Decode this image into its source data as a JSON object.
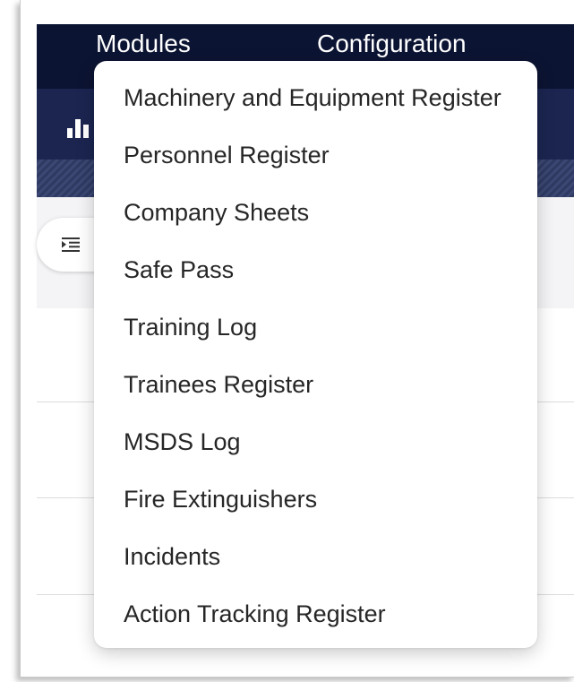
{
  "nav": {
    "modules_label": "Modules",
    "configuration_label": "Configuration"
  },
  "toolbar": {
    "chart_icon": "bar-chart-icon",
    "indent_icon": "indent-icon"
  },
  "modules_menu": {
    "items": [
      "Machinery and Equipment Register",
      "Personnel Register",
      "Company Sheets",
      "Safe Pass",
      "Training Log",
      "Trainees Register",
      "MSDS Log",
      "Fire Extinguishers",
      "Incidents",
      "Action Tracking Register"
    ]
  },
  "colors": {
    "nav_bg": "#0c1433",
    "subbar_bg": "#1b2550",
    "menu_bg": "#ffffff",
    "menu_text": "#262626"
  }
}
